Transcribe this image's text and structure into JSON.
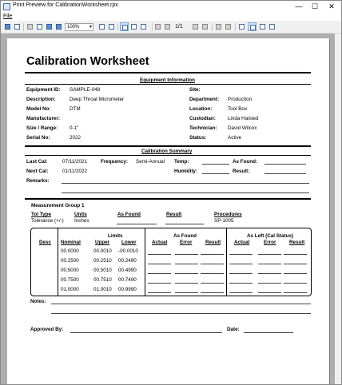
{
  "window": {
    "title": "Print Preview for CalibrationWorksheet.rpx",
    "minimize": "—",
    "maximize": "☐",
    "close": "✕"
  },
  "menu": {
    "file": "File"
  },
  "toolbar": {
    "zoom": "100%",
    "page": "1/1",
    "icons": [
      "print-icon",
      "page-setup-icon",
      "copy-icon",
      "find-icon",
      "zoom-in-icon",
      "zoom-out-icon",
      "single-page-icon",
      "multi-page-icon",
      "first-page-icon",
      "prev-page-icon",
      "next-page-icon",
      "last-page-icon",
      "back-icon",
      "forward-icon",
      "refresh-icon",
      "pan-icon",
      "select-icon"
    ]
  },
  "doc": {
    "title": "Calibration Worksheet",
    "equipment_header": "Equipment Information",
    "equipment_left": [
      {
        "label": "Equipment ID:",
        "value": "SAMPLE-048"
      },
      {
        "label": "Description:",
        "value": "Deep Throat Micrometer"
      },
      {
        "label": "Model No:",
        "value": "DTM"
      },
      {
        "label": "Manufacturer:",
        "value": ""
      },
      {
        "label": "Size / Range:",
        "value": "0-1\""
      },
      {
        "label": "Serial No:",
        "value": "2022"
      }
    ],
    "equipment_right": [
      {
        "label": "Site:",
        "value": ""
      },
      {
        "label": "Department:",
        "value": "Production"
      },
      {
        "label": "Location:",
        "value": "Tool Box"
      },
      {
        "label": "Custodian:",
        "value": "Linda Halsted"
      },
      {
        "label": "Technician:",
        "value": "David Wilcox"
      },
      {
        "label": "Status:",
        "value": "Active"
      }
    ],
    "summary_header": "Calibration Summary",
    "last_cal_label": "Last Cal:",
    "last_cal": "07/11/2021",
    "next_cal_label": "Next Cal:",
    "next_cal": "01/11/2022",
    "frequency_label": "Frequency:",
    "frequency": "Semi-Annual",
    "temp_label": "Temp:",
    "humidity_label": "Humidity:",
    "as_found_label": "As Found:",
    "result_label": "Result:",
    "remarks_label": "Remarks:",
    "group_title": "Measurement Group 1",
    "group_headers": {
      "tol_type": "Tol Type",
      "units": "Units",
      "as_found": "As Found",
      "result": "Result",
      "procedures": "Procedures"
    },
    "group_values": {
      "tol_type": "Tolerance (+/-)",
      "units": "Inches",
      "procedures": "SP-1005"
    },
    "table": {
      "desc": "Desc",
      "nominal": "Nominal",
      "limits": "Limits",
      "upper": "Upper",
      "lower": "Lower",
      "as_found": "As Found",
      "as_left": "As Left (Cal Status)",
      "actual": "Actual",
      "error": "Error",
      "result": "Result",
      "rows": [
        {
          "nominal": "00.0000",
          "upper": "00.0010",
          "lower": "-00.0010"
        },
        {
          "nominal": "00.2500",
          "upper": "00.2510",
          "lower": "00.2490"
        },
        {
          "nominal": "00.5000",
          "upper": "00.5010",
          "lower": "00.4990"
        },
        {
          "nominal": "00.7500",
          "upper": "00.7510",
          "lower": "00.7490"
        },
        {
          "nominal": "01.0000",
          "upper": "01.0010",
          "lower": "00.9990"
        }
      ]
    },
    "notes_label": "Notes:",
    "approved_label": "Approved By:",
    "date_label": "Date:"
  }
}
